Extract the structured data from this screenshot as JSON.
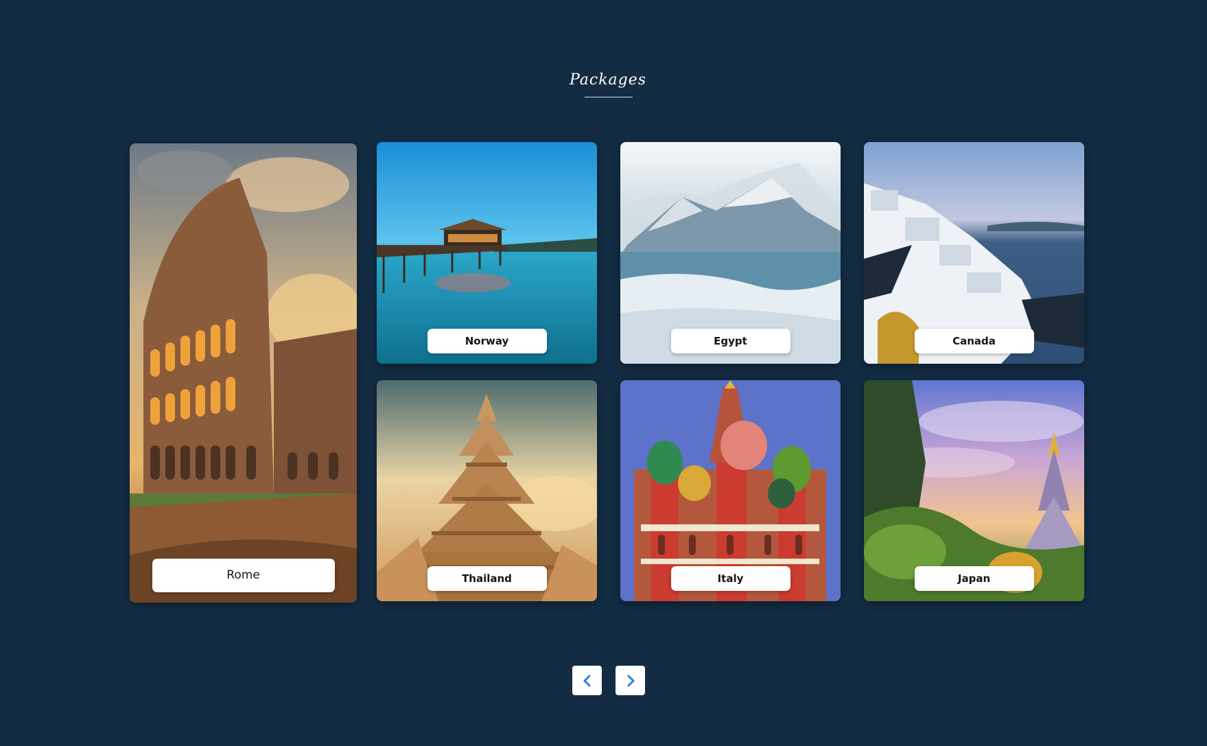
{
  "section": {
    "title": "Packages"
  },
  "packages": [
    {
      "name": "Rome"
    },
    {
      "name": "Norway"
    },
    {
      "name": "Egypt"
    },
    {
      "name": "Canada"
    },
    {
      "name": "Thailand"
    },
    {
      "name": "Italy"
    },
    {
      "name": "Japan"
    }
  ],
  "navigation": {
    "prev_icon": "chevron-left-icon",
    "next_icon": "chevron-right-icon",
    "accent_color": "#2f7de1"
  },
  "colors": {
    "background": "#132c43",
    "label_background": "#ffffff"
  }
}
